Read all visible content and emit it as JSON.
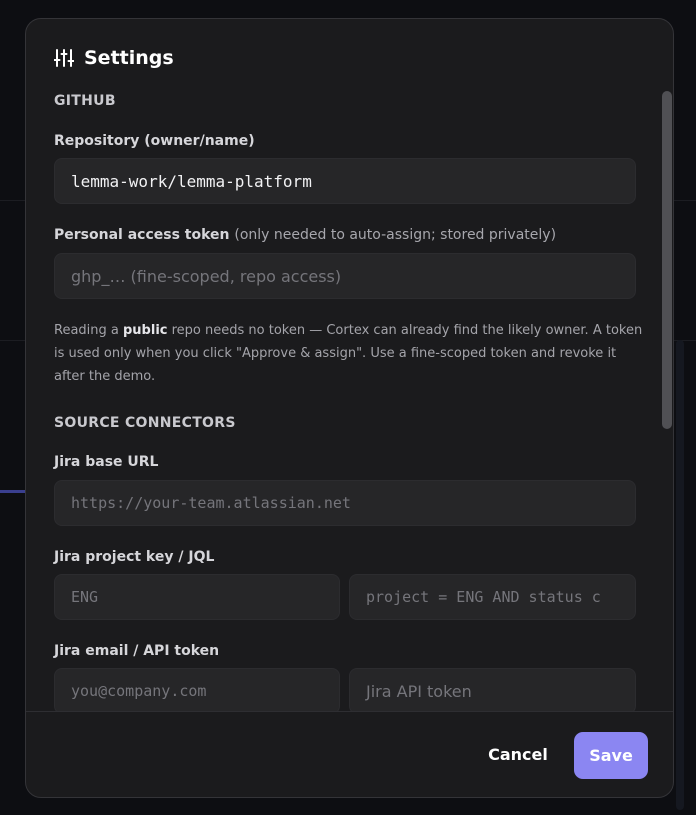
{
  "dialog": {
    "title": "Settings",
    "icon": "sliders-icon"
  },
  "github": {
    "section_title": "GITHUB",
    "repo_label": "Repository (owner/name)",
    "repo_value": "lemma-work/lemma-platform",
    "token_label": "Personal access token",
    "token_note": "(only needed to auto-assign; stored privately)",
    "token_placeholder": "ghp_… (fine-scoped, repo access)",
    "help_prefix": "Reading a ",
    "help_bold": "public",
    "help_suffix": " repo needs no token — Cortex can already find the likely owner. A token is used only when you click \"Approve & assign\". Use a fine-scoped token and revoke it after the demo."
  },
  "connectors": {
    "section_title": "SOURCE CONNECTORS",
    "jira_url_label": "Jira base URL",
    "jira_url_placeholder": "https://your-team.atlassian.net",
    "jira_key_label": "Jira project key / JQL",
    "jira_key_placeholder": "ENG",
    "jira_jql_placeholder": "project = ENG AND status c",
    "jira_email_label": "Jira email / API token",
    "jira_email_placeholder": "you@company.com",
    "jira_token_placeholder": "Jira API token"
  },
  "footer": {
    "cancel_label": "Cancel",
    "save_label": "Save"
  },
  "colors": {
    "accent": "#8b86f2",
    "dialog_bg": "#1b1b1d",
    "input_bg": "#262628"
  }
}
